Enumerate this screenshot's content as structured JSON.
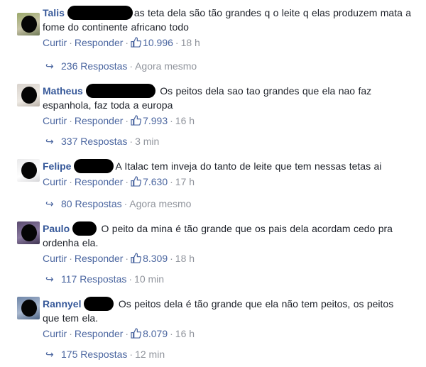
{
  "comments": [
    {
      "name": "Talis",
      "text": "as teta dela são tão grandes q o leite q elas produzem mata a fome do continente africano todo",
      "actions": {
        "like": "Curtir",
        "reply": "Responder",
        "likes": "10.996",
        "time": "18 h"
      },
      "replies": {
        "label": "236 Respostas",
        "time": "Agora mesmo"
      }
    },
    {
      "name": "Matheus",
      "text": "Os peitos dela sao tao grandes que ela nao faz espanhola, faz toda a europa",
      "actions": {
        "like": "Curtir",
        "reply": "Responder",
        "likes": "7.993",
        "time": "16 h"
      },
      "replies": {
        "label": "337 Respostas",
        "time": "3 min"
      }
    },
    {
      "name": "Felipe",
      "text": "A Italac tem inveja do tanto de leite que tem nessas tetas ai",
      "actions": {
        "like": "Curtir",
        "reply": "Responder",
        "likes": "7.630",
        "time": "17 h"
      },
      "replies": {
        "label": "80 Respostas",
        "time": "Agora mesmo"
      }
    },
    {
      "name": "Paulo",
      "text": "O peito da mina é tão grande que os pais dela acordam cedo pra ordenha ela.",
      "actions": {
        "like": "Curtir",
        "reply": "Responder",
        "likes": "8.309",
        "time": "18 h"
      },
      "replies": {
        "label": "117 Respostas",
        "time": "10 min"
      }
    },
    {
      "name": "Rannyel",
      "text": "Os peitos dela é tão grande que ela não tem peitos, os peitos que tem ela.",
      "actions": {
        "like": "Curtir",
        "reply": "Responder",
        "likes": "8.079",
        "time": "16 h"
      },
      "replies": {
        "label": "175 Respostas",
        "time": "12 min"
      }
    }
  ],
  "colors": {
    "name": "#365899",
    "link": "#4b66a0",
    "meta": "#90949c",
    "text": "#1d2129"
  },
  "icons": {
    "like": "thumbs-up-icon",
    "reply_arrow": "reply-arrow-icon"
  }
}
